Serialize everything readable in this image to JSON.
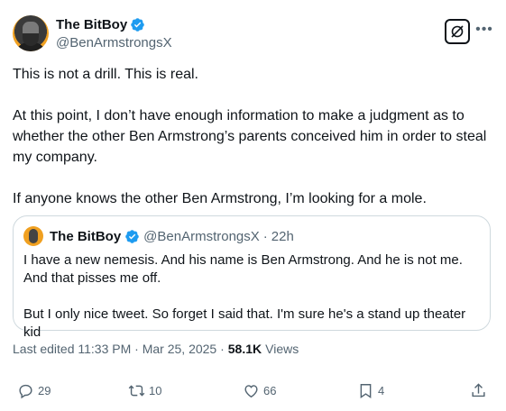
{
  "author": {
    "display_name": "The BitBoy",
    "handle": "@BenArmstrongsX"
  },
  "tweet": {
    "paragraphs": [
      "This is not a drill. This is real.",
      "At this point, I don’t have enough information to make a judgment as to whether the other Ben Armstrong’s parents conceived him in order to steal my company.",
      "If anyone knows the other Ben Armstrong, I’m looking for a mole."
    ]
  },
  "quote": {
    "display_name": "The BitBoy",
    "handle": "@BenArmstrongsX",
    "separator": "·",
    "time": "22h",
    "paragraphs": [
      "I have a new nemesis. And his name is Ben Armstrong. And he is not me. And that pisses me off.",
      "But I only nice tweet. So forget I said that. I'm sure he's a stand up theater kid"
    ]
  },
  "meta": {
    "edited": "Last edited 11:33 PM · Mar 25, 2025 ·",
    "views_count": "58.1K",
    "views_label": "Views"
  },
  "actions": {
    "replies": "29",
    "reposts": "10",
    "likes": "66",
    "bookmarks": "4"
  },
  "colors": {
    "verified": "#1d9bf0",
    "secondary_text": "#536471",
    "primary_text": "#0f1419",
    "border": "#cfd9de"
  },
  "icons": [
    "verified-badge-icon",
    "grok-icon",
    "more-icon",
    "reply-icon",
    "repost-icon",
    "like-icon",
    "bookmark-icon",
    "share-icon"
  ]
}
